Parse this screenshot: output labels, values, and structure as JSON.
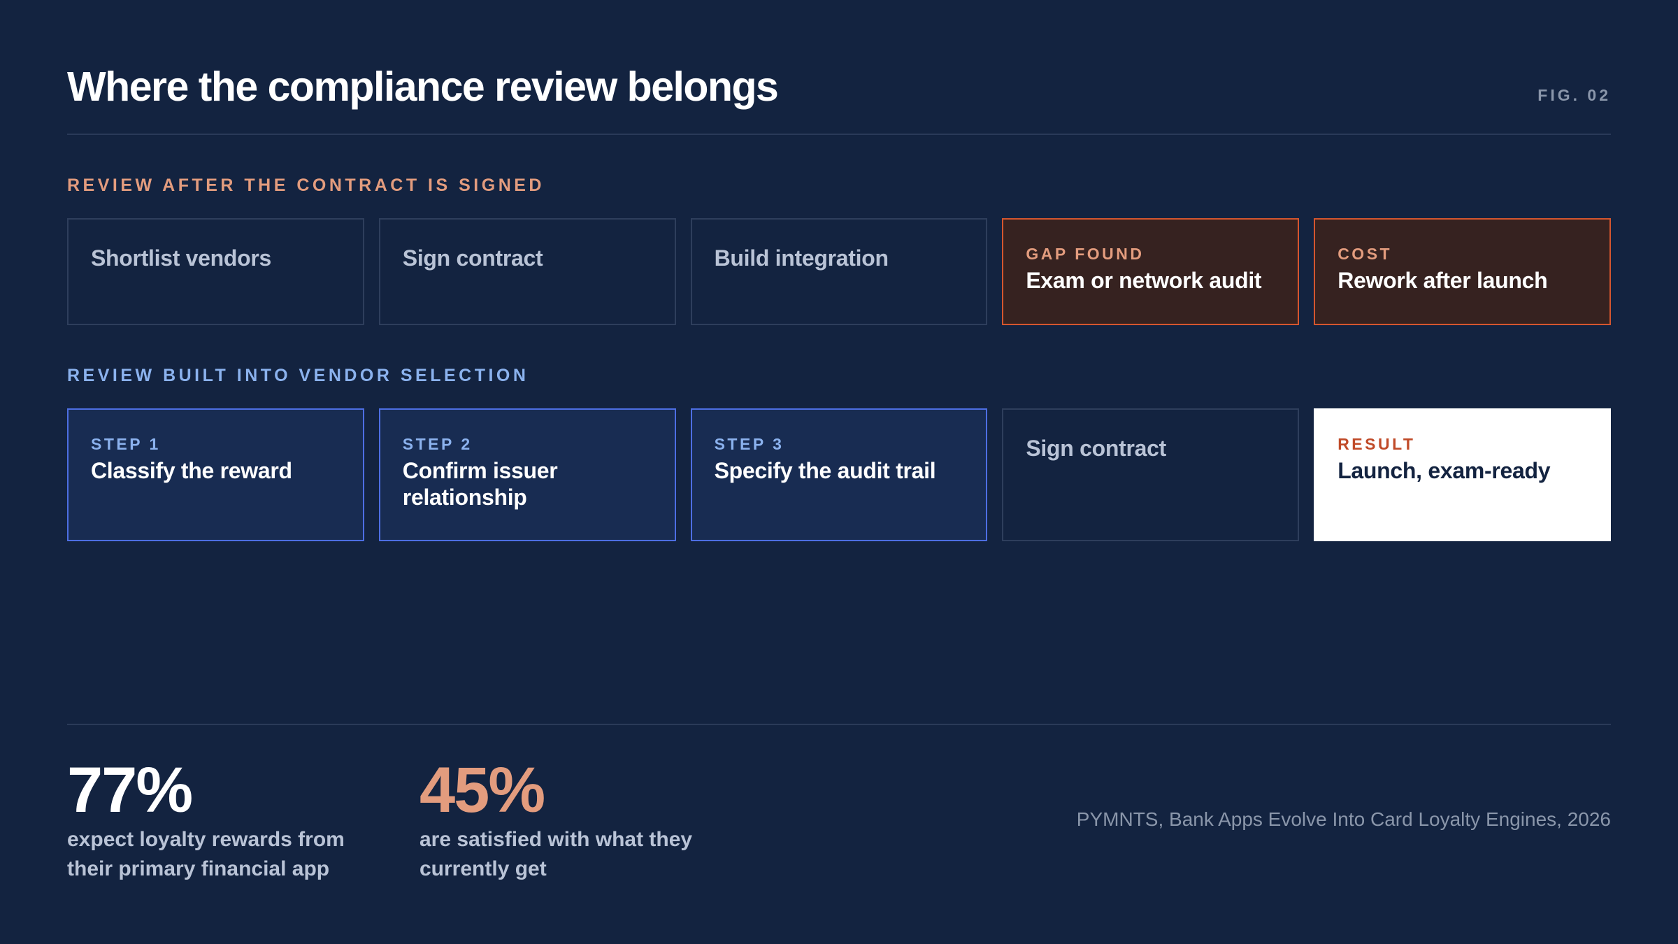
{
  "header": {
    "title": "Where the compliance review belongs",
    "fig_label": "FIG. 02"
  },
  "colors": {
    "background": "#132340",
    "after_accent": "#e39c7e",
    "built_accent": "#8bb2ee",
    "gap_border": "#d4562f",
    "step_border": "#4d6ee3",
    "result_tag": "#c04a28"
  },
  "section_after": {
    "label": "REVIEW AFTER THE CONTRACT IS SIGNED",
    "boxes": [
      {
        "tag": "",
        "text": "Shortlist vendors"
      },
      {
        "tag": "",
        "text": "Sign contract"
      },
      {
        "tag": "",
        "text": "Build integration"
      },
      {
        "tag": "GAP FOUND",
        "text": "Exam or network audit"
      },
      {
        "tag": "COST",
        "text": "Rework after launch"
      }
    ]
  },
  "section_built": {
    "label": "REVIEW BUILT INTO VENDOR SELECTION",
    "boxes": [
      {
        "tag": "STEP 1",
        "text": "Classify the reward"
      },
      {
        "tag": "STEP 2",
        "text": "Confirm issuer relationship"
      },
      {
        "tag": "STEP 3",
        "text": "Specify the audit trail"
      },
      {
        "tag": "",
        "text": "Sign contract"
      },
      {
        "tag": "RESULT",
        "text": "Launch, exam-ready"
      }
    ]
  },
  "stats": [
    {
      "value": "77%",
      "caption": "expect loyalty rewards from their primary financial app"
    },
    {
      "value": "45%",
      "caption": "are satisfied with what they currently get"
    }
  ],
  "source": "PYMNTS, Bank Apps Evolve Into Card Loyalty Engines, 2026"
}
